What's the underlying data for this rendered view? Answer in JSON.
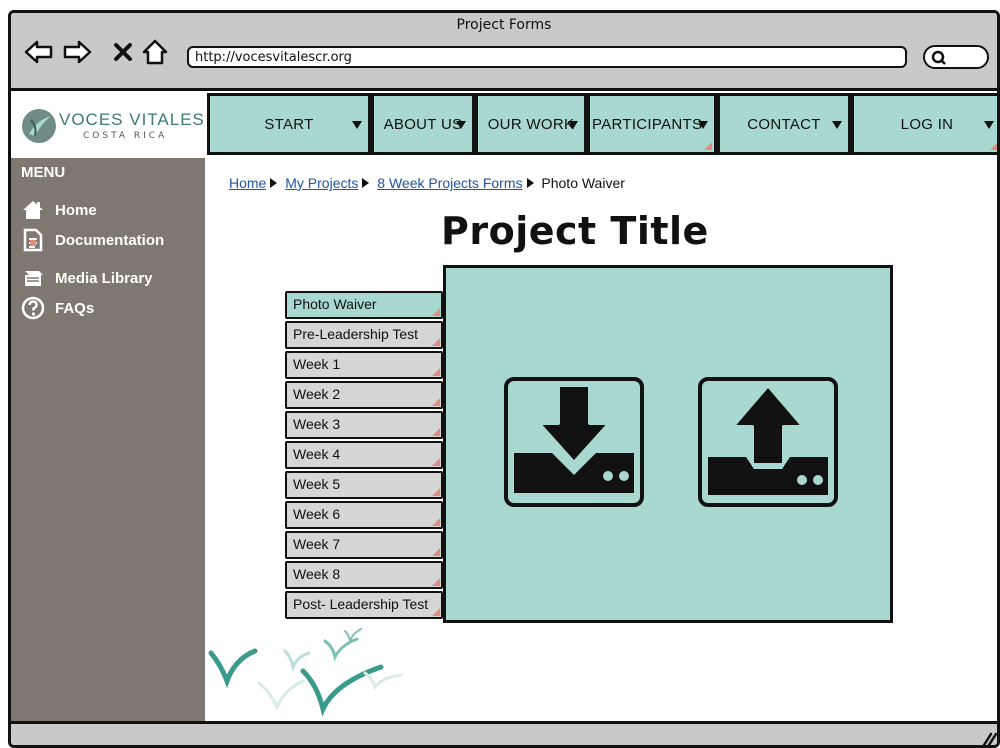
{
  "window": {
    "title": "Project Forms"
  },
  "browser": {
    "url": "http://vocesvitalescr.org"
  },
  "logo": {
    "line1": "VOCES VITALES",
    "line2": "COSTA RICA"
  },
  "nav": {
    "items": [
      {
        "label": "START"
      },
      {
        "label": "ABOUT US"
      },
      {
        "label": "OUR WORK"
      },
      {
        "label": "PARTICIPANTS"
      },
      {
        "label": "CONTACT"
      },
      {
        "label": "LOG IN"
      }
    ]
  },
  "sidebar": {
    "title": "MENU",
    "items": [
      {
        "label": "Home",
        "icon": "home-icon"
      },
      {
        "label": "Documentation",
        "icon": "document-icon"
      },
      {
        "label": "Media Library",
        "icon": "book-icon"
      },
      {
        "label": "FAQs",
        "icon": "question-icon"
      }
    ]
  },
  "breadcrumb": {
    "home": "Home",
    "projects": "My Projects",
    "forms": "8 Week Projects Forms",
    "current": "Photo Waiver"
  },
  "page": {
    "title": "Project Title"
  },
  "tabs": [
    {
      "label": "Photo Waiver"
    },
    {
      "label": "Pre-Leadership Test"
    },
    {
      "label": "Week 1"
    },
    {
      "label": "Week 2"
    },
    {
      "label": "Week 3"
    },
    {
      "label": "Week 4"
    },
    {
      "label": "Week 5"
    },
    {
      "label": "Week 6"
    },
    {
      "label": "Week 7"
    },
    {
      "label": "Week 8"
    },
    {
      "label": "Post- Leadership Test"
    }
  ],
  "colors": {
    "accent": "#a8d8d0",
    "sidebar": "#7f7871",
    "chrome": "#c9c9c9",
    "link": "#1f55a8",
    "flag": "#e08d80"
  },
  "panel": {
    "icons": [
      "download-icon",
      "upload-icon"
    ]
  }
}
